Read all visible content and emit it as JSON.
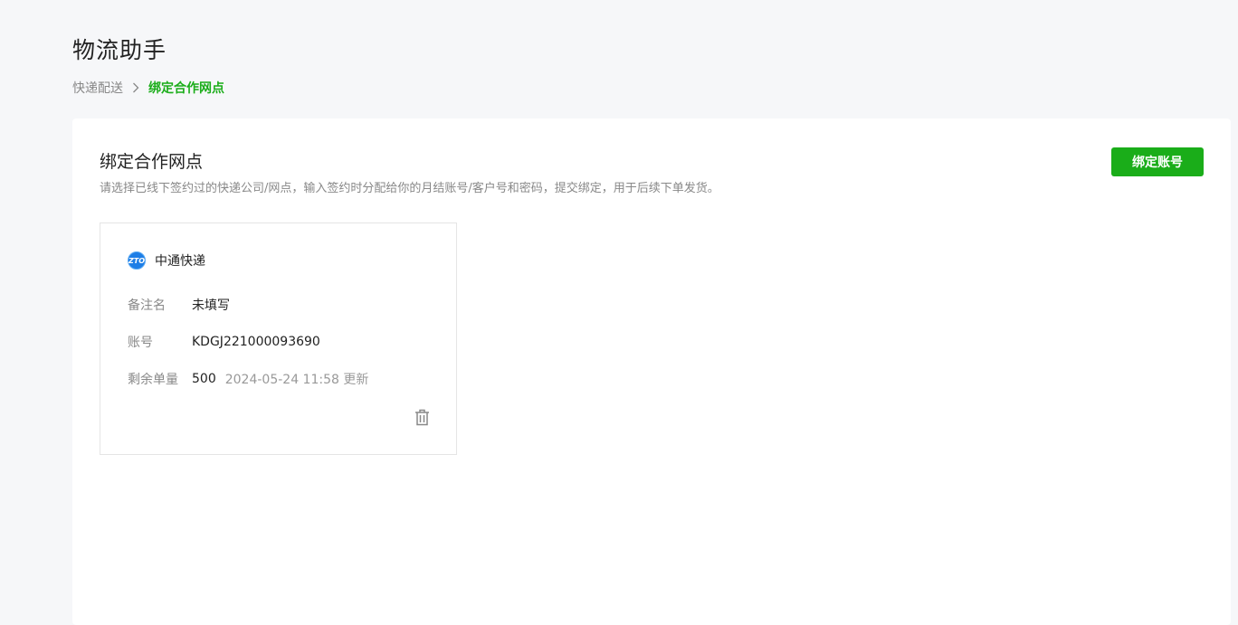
{
  "page": {
    "title": "物流助手"
  },
  "breadcrumb": {
    "parent": "快递配送",
    "current": "绑定合作网点"
  },
  "panel": {
    "title": "绑定合作网点",
    "description": "请选择已线下签约过的快递公司/网点，输入签约时分配给你的月结账号/客户号和密码，提交绑定，用于后续下单发货。",
    "bind_button": "绑定账号",
    "accent_color": "#1aad19"
  },
  "accounts": [
    {
      "carrier_logo_text": "ZTO",
      "carrier_name": "中通快递",
      "remark_label": "备注名",
      "remark_value": "未填写",
      "account_label": "账号",
      "account_value": "KDGJ221000093690",
      "remaining_label": "剩余单量",
      "remaining_value": "500",
      "updated_text": "2024-05-24 11:58 更新",
      "delete_icon": "trash-icon"
    }
  ]
}
